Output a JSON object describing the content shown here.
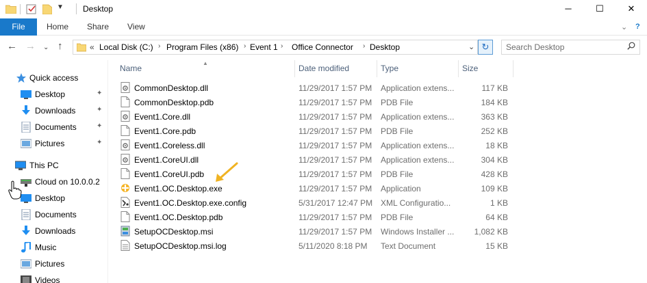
{
  "window": {
    "title": "Desktop",
    "minimize_glyph": "─",
    "maximize_glyph": "☐",
    "close_glyph": "✕"
  },
  "ribbon": {
    "tabs": [
      "File",
      "Home",
      "Share",
      "View"
    ],
    "expand_glyph": "⌄",
    "help_glyph": "?"
  },
  "address": {
    "back_glyph": "←",
    "forward_glyph": "→",
    "recent_glyph": "⌄",
    "up_glyph": "↑",
    "overflow": "«",
    "crumbs": [
      "Local Disk (C:)",
      "Program Files (x86)",
      "Event 1",
      "Office Connector",
      "Desktop"
    ],
    "separator": "›",
    "dropdown_glyph": "⌄",
    "refresh_glyph": "↻"
  },
  "search": {
    "placeholder": "Search Desktop",
    "icon": "search-icon"
  },
  "nav": {
    "quick_access": "Quick access",
    "quick_items": [
      {
        "label": "Desktop",
        "icon": "desktop-folder-icon"
      },
      {
        "label": "Downloads",
        "icon": "downloads-folder-icon"
      },
      {
        "label": "Documents",
        "icon": "documents-folder-icon"
      },
      {
        "label": "Pictures",
        "icon": "pictures-folder-icon"
      }
    ],
    "this_pc": "This PC",
    "pc_items": [
      {
        "label": "Cloud on 10.0.0.2",
        "icon": "network-drive-icon"
      },
      {
        "label": "Desktop",
        "icon": "desktop-folder-icon"
      },
      {
        "label": "Documents",
        "icon": "documents-folder-icon"
      },
      {
        "label": "Downloads",
        "icon": "downloads-folder-icon"
      },
      {
        "label": "Music",
        "icon": "music-folder-icon"
      },
      {
        "label": "Pictures",
        "icon": "pictures-folder-icon"
      },
      {
        "label": "Videos",
        "icon": "videos-folder-icon"
      }
    ],
    "pin_glyph": "✦"
  },
  "columns": {
    "name": "Name",
    "date": "Date modified",
    "type": "Type",
    "size": "Size"
  },
  "files": [
    {
      "name": "CommonDesktop.dll",
      "date": "11/29/2017 1:57 PM",
      "type": "Application extens...",
      "size": "117 KB",
      "icon": "dll-file-icon"
    },
    {
      "name": "CommonDesktop.pdb",
      "date": "11/29/2017 1:57 PM",
      "type": "PDB File",
      "size": "184 KB",
      "icon": "generic-file-icon"
    },
    {
      "name": "Event1.Core.dll",
      "date": "11/29/2017 1:57 PM",
      "type": "Application extens...",
      "size": "363 KB",
      "icon": "dll-file-icon"
    },
    {
      "name": "Event1.Core.pdb",
      "date": "11/29/2017 1:57 PM",
      "type": "PDB File",
      "size": "252 KB",
      "icon": "generic-file-icon"
    },
    {
      "name": "Event1.Coreless.dll",
      "date": "11/29/2017 1:57 PM",
      "type": "Application extens...",
      "size": "18 KB",
      "icon": "dll-file-icon"
    },
    {
      "name": "Event1.CoreUI.dll",
      "date": "11/29/2017 1:57 PM",
      "type": "Application extens...",
      "size": "304 KB",
      "icon": "dll-file-icon"
    },
    {
      "name": "Event1.CoreUI.pdb",
      "date": "11/29/2017 1:57 PM",
      "type": "PDB File",
      "size": "428 KB",
      "icon": "generic-file-icon"
    },
    {
      "name": "Event1.OC.Desktop.exe",
      "date": "11/29/2017 1:57 PM",
      "type": "Application",
      "size": "109 KB",
      "icon": "exe-app-icon"
    },
    {
      "name": "Event1.OC.Desktop.exe.config",
      "date": "5/31/2017 12:47 PM",
      "type": "XML Configuratio...",
      "size": "1 KB",
      "icon": "config-file-icon"
    },
    {
      "name": "Event1.OC.Desktop.pdb",
      "date": "11/29/2017 1:57 PM",
      "type": "PDB File",
      "size": "64 KB",
      "icon": "generic-file-icon"
    },
    {
      "name": "SetupOCDesktop.msi",
      "date": "11/29/2017 1:57 PM",
      "type": "Windows Installer ...",
      "size": "1,082 KB",
      "icon": "msi-installer-icon"
    },
    {
      "name": "SetupOCDesktop.msi.log",
      "date": "5/11/2020 8:18 PM",
      "type": "Text Document",
      "size": "15 KB",
      "icon": "text-file-icon"
    }
  ],
  "colors": {
    "accent": "#1979ca",
    "folder_yellow": "#f8d775",
    "annotation_arrow": "#f0b323",
    "muted_text": "#6d6d6d",
    "header_text": "#4c607a"
  }
}
